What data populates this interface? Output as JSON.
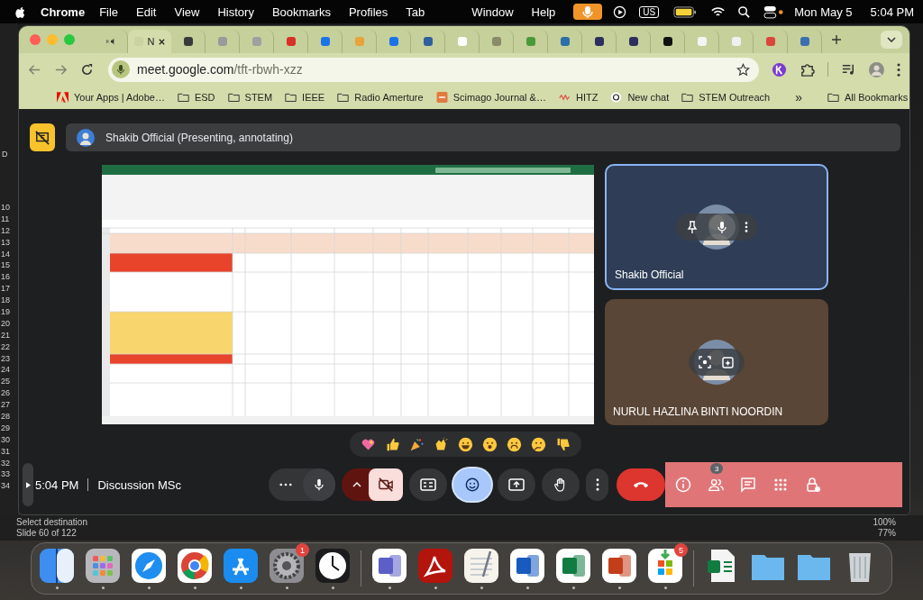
{
  "menubar": {
    "app": "Chrome",
    "menus": [
      "File",
      "Edit",
      "View",
      "History",
      "Bookmarks",
      "Profiles",
      "Tab"
    ],
    "menus_right": [
      "Window",
      "Help"
    ],
    "keyboard": "US",
    "date": "Mon May 5",
    "time": "5:04 PM"
  },
  "browser": {
    "tabs": [
      {
        "selected": false,
        "kind": "audio"
      },
      {
        "selected": true,
        "kind": "page",
        "label": "N",
        "color": "#c9d3a0"
      },
      {
        "selected": false,
        "kind": "page",
        "color": "#3a3a3a"
      },
      {
        "selected": false,
        "kind": "page",
        "color": "#9a9a9a"
      },
      {
        "selected": false,
        "kind": "page",
        "color": "#a0a0a0"
      },
      {
        "selected": false,
        "kind": "page",
        "color": "#d93025"
      },
      {
        "selected": false,
        "kind": "page",
        "color": "#1a73e8"
      },
      {
        "selected": false,
        "kind": "page",
        "color": "#e8a33a"
      },
      {
        "selected": false,
        "kind": "page",
        "color": "#1a73e8"
      },
      {
        "selected": false,
        "kind": "page",
        "color": "#2f5f9e"
      },
      {
        "selected": false,
        "kind": "page",
        "color": "#ffffff"
      },
      {
        "selected": false,
        "kind": "page",
        "color": "#8a8a6a"
      },
      {
        "selected": false,
        "kind": "page",
        "color": "#4a9a3a"
      },
      {
        "selected": false,
        "kind": "page",
        "color": "#2d6fa8"
      },
      {
        "selected": false,
        "kind": "page",
        "color": "#2c2f5e"
      },
      {
        "selected": false,
        "kind": "page",
        "color": "#2c2f5e"
      },
      {
        "selected": false,
        "kind": "page",
        "color": "#111111"
      },
      {
        "selected": false,
        "kind": "page",
        "color": "#f4f4f4"
      },
      {
        "selected": false,
        "kind": "page",
        "color": "#f0f0f0"
      },
      {
        "selected": false,
        "kind": "page",
        "color": "#d9473a"
      },
      {
        "selected": false,
        "kind": "page",
        "color": "#3b6fb0"
      }
    ],
    "url_host": "meet.google.com",
    "url_path": "/tft-rbwh-xzz",
    "bookmarks": [
      {
        "kind": "adobe",
        "label": "Your Apps | Adobe…"
      },
      {
        "kind": "folder",
        "label": "ESD"
      },
      {
        "kind": "folder",
        "label": "STEM"
      },
      {
        "kind": "folder",
        "label": "IEEE"
      },
      {
        "kind": "folder",
        "label": "Radio Amerture"
      },
      {
        "kind": "sjr",
        "label": "Scimago Journal &…"
      },
      {
        "kind": "wave",
        "label": "HITZ"
      },
      {
        "kind": "chat",
        "label": "New chat"
      },
      {
        "kind": "folder",
        "label": "STEM Outreach"
      }
    ],
    "more_bookmarks": "»",
    "all_bookmarks": "All Bookmarks"
  },
  "meet": {
    "presenter_banner": "Shakib Official (Presenting, annotating)",
    "participants": [
      {
        "name": "Shakib Official",
        "highlighted": true,
        "color": "#2f3e56",
        "overlay": [
          {
            "kind": "pin"
          },
          {
            "kind": "mic"
          },
          {
            "kind": "more"
          }
        ]
      },
      {
        "name": "NURUL HAZLINA BINTI NOORDIN",
        "highlighted": false,
        "color": "#5a4636",
        "overlay": [
          {
            "kind": "frame"
          },
          {
            "kind": "effects"
          }
        ]
      }
    ],
    "reactions": [
      {
        "kind": "heart"
      },
      {
        "kind": "thumbs-up"
      },
      {
        "kind": "party"
      },
      {
        "kind": "clap"
      },
      {
        "kind": "laugh"
      },
      {
        "kind": "surprised"
      },
      {
        "kind": "sad"
      },
      {
        "kind": "thinking"
      },
      {
        "kind": "thumbs-down"
      }
    ],
    "time": "5:04 PM",
    "meeting_title": "Discussion MSc",
    "controls": [
      {
        "kind": "mic",
        "selected": false,
        "off": false
      },
      {
        "kind": "camera",
        "selected": false,
        "off": true
      },
      {
        "kind": "captions",
        "selected": false
      },
      {
        "kind": "emoji",
        "selected": true
      },
      {
        "kind": "present",
        "selected": false
      },
      {
        "kind": "hand",
        "selected": false
      },
      {
        "kind": "more",
        "selected": false
      },
      {
        "kind": "end",
        "selected": false
      }
    ],
    "side_controls": [
      {
        "kind": "info"
      },
      {
        "kind": "people",
        "badge": "3"
      },
      {
        "kind": "chat"
      },
      {
        "kind": "activities"
      },
      {
        "kind": "host"
      }
    ]
  },
  "behind": {
    "column_letter": "D",
    "row_numbers": [
      "10",
      "11",
      "12",
      "13",
      "14",
      "15",
      "16",
      "17",
      "18",
      "19",
      "20",
      "21",
      "22",
      "23",
      "24",
      "25",
      "26",
      "27",
      "28",
      "29",
      "30",
      "31",
      "32",
      "33",
      "34"
    ],
    "left_texts": [
      "Select destination",
      "Slide 60 of 122"
    ],
    "right_texts": [
      "100%",
      "77%"
    ]
  },
  "dock": [
    {
      "kind": "finder",
      "running": true
    },
    {
      "kind": "launchpad",
      "running": true
    },
    {
      "kind": "safari",
      "running": true
    },
    {
      "kind": "chrome",
      "running": true
    },
    {
      "kind": "appstore",
      "running": true
    },
    {
      "kind": "settings",
      "running": true,
      "badge": "1"
    },
    {
      "kind": "clock",
      "running": true
    },
    {
      "kind": "separator"
    },
    {
      "kind": "teams",
      "running": true
    },
    {
      "kind": "acrobat",
      "running": true
    },
    {
      "kind": "textedit",
      "running": true
    },
    {
      "kind": "word",
      "running": true
    },
    {
      "kind": "excel",
      "running": true
    },
    {
      "kind": "powerpoint",
      "running": true
    },
    {
      "kind": "store",
      "running": true,
      "badge": "5"
    },
    {
      "kind": "separator"
    },
    {
      "kind": "excelfile",
      "running": false
    },
    {
      "kind": "folder",
      "running": false
    },
    {
      "kind": "folder",
      "running": false
    },
    {
      "kind": "trash",
      "running": false
    }
  ]
}
